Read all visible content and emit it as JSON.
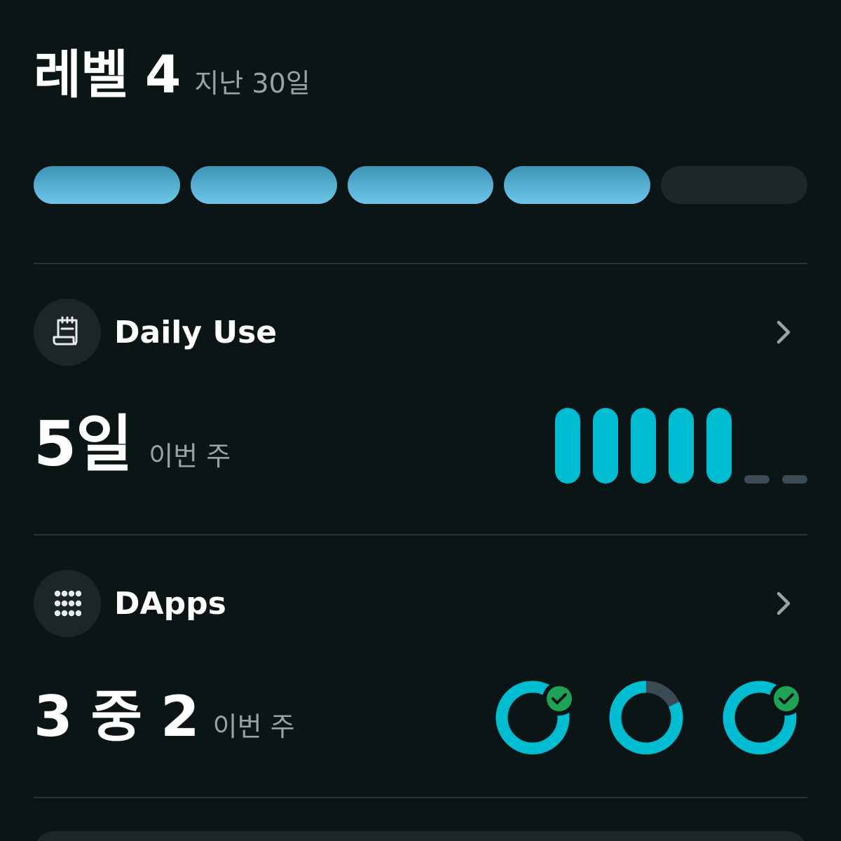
{
  "header": {
    "title": "레벨 4",
    "subtitle": "지난 30일"
  },
  "level_progress": {
    "segments_filled": 4,
    "segments_total": 5,
    "fill_color": "#5ab3d6",
    "empty_color": "#1e2628"
  },
  "daily_use": {
    "icon": "calendar-note-icon",
    "title": "Daily Use",
    "value": "5일",
    "period": "이번 주",
    "days_active": [
      true,
      true,
      true,
      true,
      true,
      false,
      false
    ],
    "active_color": "#00bcd0",
    "inactive_color": "#3b4b55"
  },
  "dapps": {
    "icon": "grid-dots-icon",
    "title": "DApps",
    "value": "3 중 2",
    "period": "이번 주",
    "items": [
      {
        "progress": 0.82,
        "completed": true
      },
      {
        "progress": 0.82,
        "completed": false
      },
      {
        "progress": 0.82,
        "completed": true
      }
    ],
    "ring_color": "#00bcd0",
    "ring_track_color": "#3b4b55",
    "check_color": "#1fa255"
  },
  "colors": {
    "background": "#0c1516",
    "divider": "#283436",
    "muted_text": "#97a3a5"
  }
}
